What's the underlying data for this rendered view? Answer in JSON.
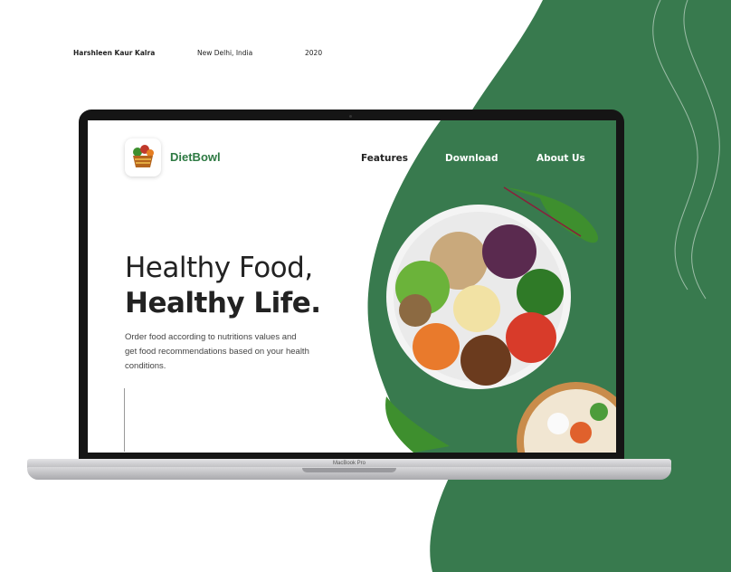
{
  "header": {
    "author": "Harshleen Kaur Kalra",
    "location": "New Delhi, India",
    "year": "2020"
  },
  "laptop": {
    "model_label": "MacBook Pro"
  },
  "app": {
    "brand": "DietBowl",
    "nav": {
      "features": "Features",
      "download": "Download",
      "about": "About Us"
    },
    "hero": {
      "title_line1": "Healthy Food,",
      "title_line2": "Healthy Life.",
      "description": "Order food according to nutritions values and get food recommendations based on your health conditions."
    }
  },
  "colors": {
    "brand_green": "#2e7a43",
    "shape_green": "#387a4e",
    "text_dark": "#222222"
  },
  "icons": {
    "logo": "salad-basket-icon"
  }
}
